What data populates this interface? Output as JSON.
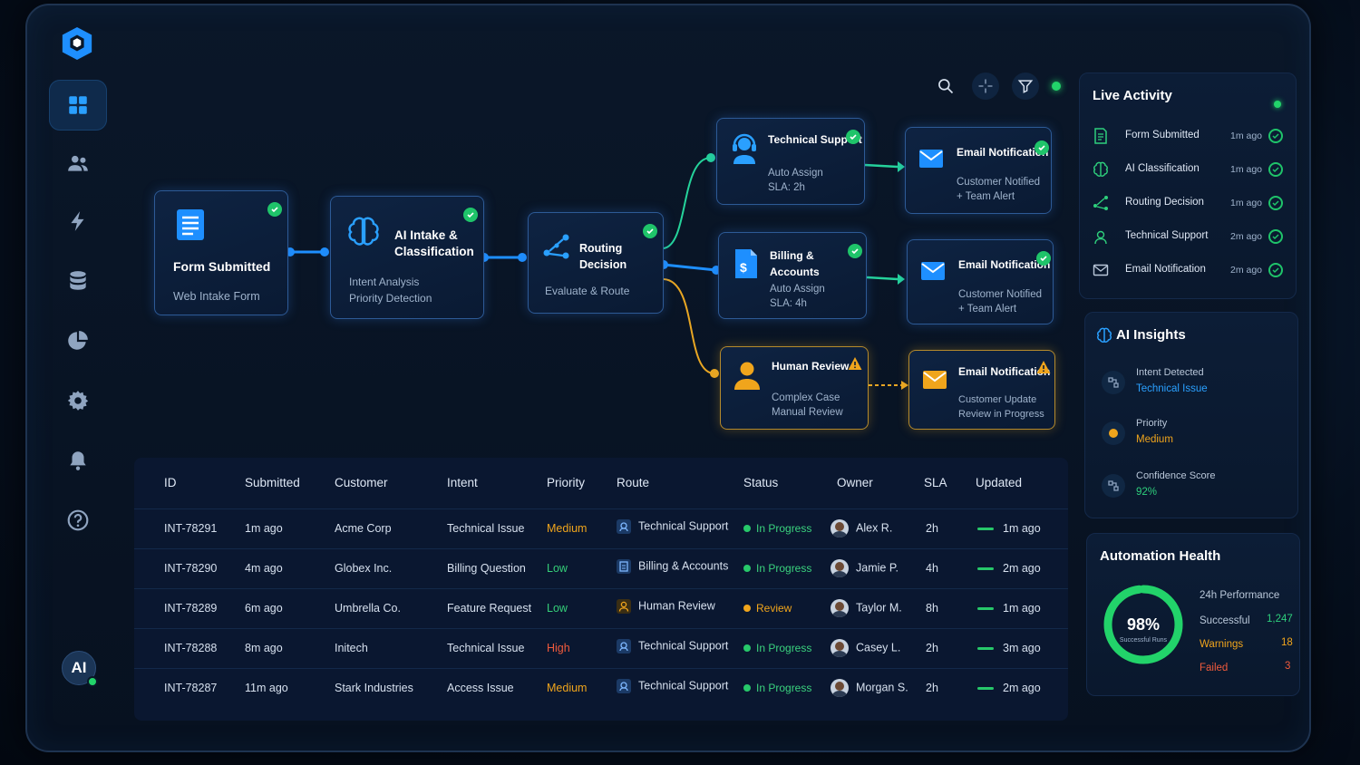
{
  "toolbar": {
    "icons": [
      "search-icon",
      "crosshair-icon",
      "filter-icon"
    ],
    "status_color": "#22d36a"
  },
  "sidebar": {
    "items": [
      "dashboard-icon",
      "users-icon",
      "bolt-icon",
      "database-icon",
      "pie-chart-icon",
      "gear-icon",
      "bell-icon",
      "help-icon"
    ],
    "avatar_label": "AI"
  },
  "workflow": {
    "form": {
      "title": "Form Submitted",
      "sub": "Web Intake Form"
    },
    "intake": {
      "title1": "AI Intake &",
      "title2": "Classification",
      "sub1": "Intent Analysis",
      "sub2": "Priority Detection"
    },
    "routing": {
      "title": "Routing Decision",
      "sub": "Evaluate & Route"
    },
    "tech": {
      "title": "Technical Support",
      "sub1": "Auto Assign",
      "sub2": "SLA: 2h"
    },
    "billing": {
      "title": "Billing & Accounts",
      "sub1": "Auto Assign",
      "sub2": "SLA: 4h"
    },
    "human": {
      "title": "Human Review",
      "sub1": "Complex Case",
      "sub2": "Manual Review"
    },
    "email1": {
      "title": "Email Notification",
      "sub1": "Customer Notified",
      "sub2": "+ Team Alert"
    },
    "email2": {
      "title": "Email Notification",
      "sub1": "Customer Notified",
      "sub2": "+ Team Alert"
    },
    "email3": {
      "title": "Email Notification",
      "sub1": "Customer Update",
      "sub2": "Review in Progress"
    }
  },
  "table": {
    "headers": [
      "ID",
      "Submitted",
      "Customer",
      "Intent",
      "Priority",
      "Route",
      "Status",
      "Owner",
      "SLA",
      "Updated"
    ],
    "rows": [
      {
        "id": "INT-78291",
        "submitted": "1m ago",
        "customer": "Acme Corp",
        "intent": "Technical Issue",
        "priority": "Medium",
        "route": "Technical Support",
        "status": "In Progress",
        "owner": "Alex R.",
        "sla": "2h",
        "updated": "1m ago"
      },
      {
        "id": "INT-78290",
        "submitted": "4m ago",
        "customer": "Globex Inc.",
        "intent": "Billing Question",
        "priority": "Low",
        "route": "Billing & Accounts",
        "status": "In Progress",
        "owner": "Jamie P.",
        "sla": "4h",
        "updated": "2m ago"
      },
      {
        "id": "INT-78289",
        "submitted": "6m ago",
        "customer": "Umbrella Co.",
        "intent": "Feature Request",
        "priority": "Low",
        "route": "Human Review",
        "status": "Review",
        "owner": "Taylor M.",
        "sla": "8h",
        "updated": "1m ago"
      },
      {
        "id": "INT-78288",
        "submitted": "8m ago",
        "customer": "Initech",
        "intent": "Technical Issue",
        "priority": "High",
        "route": "Technical Support",
        "status": "In Progress",
        "owner": "Casey L.",
        "sla": "2h",
        "updated": "3m ago"
      },
      {
        "id": "INT-78287",
        "submitted": "11m ago",
        "customer": "Stark Industries",
        "intent": "Access Issue",
        "priority": "Medium",
        "route": "Technical Support",
        "status": "In Progress",
        "owner": "Morgan S.",
        "sla": "2h",
        "updated": "2m ago"
      }
    ]
  },
  "live_activity": {
    "title": "Live Activity",
    "items": [
      {
        "label": "Form Submitted",
        "time": "1m ago"
      },
      {
        "label": "AI Classification",
        "time": "1m ago"
      },
      {
        "label": "Routing Decision",
        "time": "1m ago"
      },
      {
        "label": "Technical Support",
        "time": "2m ago"
      },
      {
        "label": "Email Notification",
        "time": "2m ago"
      }
    ]
  },
  "ai_insights": {
    "title": "AI Insights",
    "intent_label": "Intent Detected",
    "intent_value": "Technical Issue",
    "priority_label": "Priority",
    "priority_value": "Medium",
    "confidence_label": "Confidence Score",
    "confidence_value": "92%"
  },
  "automation_health": {
    "title": "Automation Health",
    "percent": "98%",
    "percent_value": 0.98,
    "percent_sub": "Successful Runs",
    "perf_title": "24h Performance",
    "successful_label": "Successful",
    "successful_value": "1,247",
    "warnings_label": "Warnings",
    "warnings_value": "18",
    "failed_label": "Failed",
    "failed_value": "3"
  },
  "colors": {
    "accent": "#1e8fff",
    "success": "#22d36a",
    "warning": "#f0a51c",
    "danger": "#f05a3c"
  }
}
